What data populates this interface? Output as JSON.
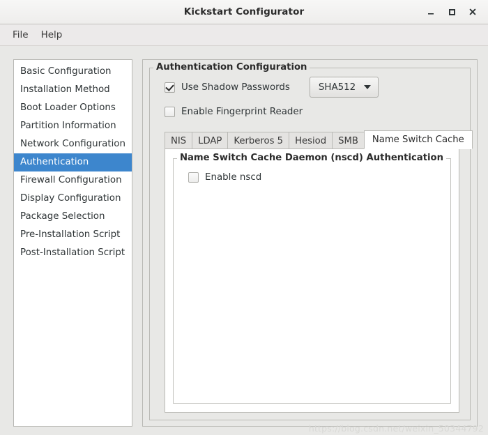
{
  "window": {
    "title": "Kickstart Configurator",
    "controls": [
      {
        "name": "minimize",
        "glyph": "minimize-icon"
      },
      {
        "name": "maximize",
        "glyph": "maximize-icon"
      },
      {
        "name": "close",
        "glyph": "close-icon"
      }
    ]
  },
  "menubar": {
    "items": [
      {
        "label": "File"
      },
      {
        "label": "Help"
      }
    ]
  },
  "sidebar": {
    "items": [
      {
        "label": "Basic Configuration",
        "selected": false
      },
      {
        "label": "Installation Method",
        "selected": false
      },
      {
        "label": "Boot Loader Options",
        "selected": false
      },
      {
        "label": "Partition Information",
        "selected": false
      },
      {
        "label": "Network Configuration",
        "selected": false
      },
      {
        "label": "Authentication",
        "selected": true
      },
      {
        "label": "Firewall Configuration",
        "selected": false
      },
      {
        "label": "Display Configuration",
        "selected": false
      },
      {
        "label": "Package Selection",
        "selected": false
      },
      {
        "label": "Pre-Installation Script",
        "selected": false
      },
      {
        "label": "Post-Installation Script",
        "selected": false
      }
    ],
    "selected_label": "Authentication",
    "selection_color": "#3d86cd"
  },
  "main": {
    "group_title": "Authentication Configuration",
    "shadow_passwords": {
      "label": "Use Shadow Passwords",
      "checked": true
    },
    "hash_combo": {
      "value": "SHA512",
      "arrow": "chevron-down-icon"
    },
    "fingerprint": {
      "label": "Enable Fingerprint Reader",
      "checked": false
    },
    "tabs": [
      {
        "label": "NIS",
        "active": false
      },
      {
        "label": "LDAP",
        "active": false
      },
      {
        "label": "Kerberos 5",
        "active": false
      },
      {
        "label": "Hesiod",
        "active": false
      },
      {
        "label": "SMB",
        "active": false
      },
      {
        "label": "Name Switch Cache",
        "active": true
      }
    ],
    "active_tab": "Name Switch Cache",
    "tab_page": {
      "group_title": "Name Switch Cache Daemon (nscd) Authentication",
      "enable_nscd": {
        "label": "Enable nscd",
        "checked": false
      }
    }
  },
  "watermark": {
    "text": "https://blog.csdn.net/weixin_50344792"
  }
}
